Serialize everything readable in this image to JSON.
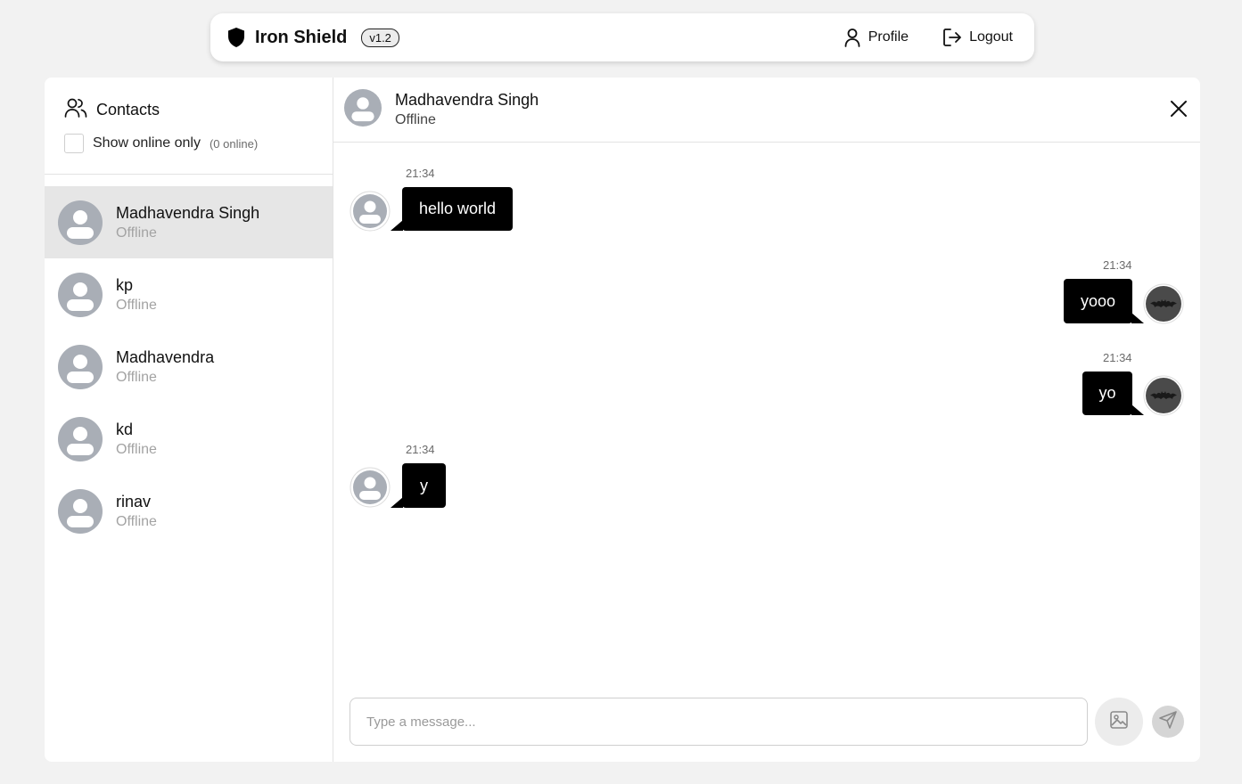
{
  "navbar": {
    "brand_name": "Iron Shield",
    "version": "v1.2",
    "profile_label": "Profile",
    "logout_label": "Logout"
  },
  "sidebar": {
    "title": "Contacts",
    "show_online_label": "Show online only",
    "online_count": "(0 online)",
    "contacts": [
      {
        "name": "Madhavendra Singh",
        "status": "Offline"
      },
      {
        "name": "kp",
        "status": "Offline"
      },
      {
        "name": "Madhavendra",
        "status": "Offline"
      },
      {
        "name": "kd",
        "status": "Offline"
      },
      {
        "name": "rinav",
        "status": "Offline"
      }
    ]
  },
  "chat": {
    "contact_name": "Madhavendra Singh",
    "contact_status": "Offline",
    "messages": [
      {
        "from": "them",
        "time": "21:34",
        "text": "hello world"
      },
      {
        "from": "me",
        "time": "21:34",
        "text": "yooo"
      },
      {
        "from": "me",
        "time": "21:34",
        "text": "yo"
      },
      {
        "from": "them",
        "time": "21:34",
        "text": "y"
      }
    ],
    "input_placeholder": "Type a message..."
  },
  "icons": {
    "brand": "shield-icon",
    "profile": "user-icon",
    "logout": "logout-icon",
    "contacts": "users-icon",
    "close": "close-icon",
    "attach_image": "image-icon",
    "send": "send-icon"
  }
}
